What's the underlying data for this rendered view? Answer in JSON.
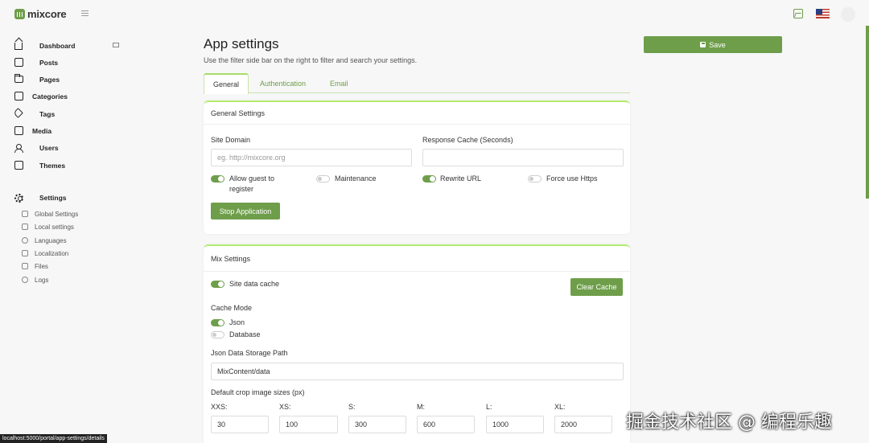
{
  "brand": {
    "name": "mixcore"
  },
  "sidebar": {
    "items": [
      {
        "label": "Dashboard"
      },
      {
        "label": "Posts"
      },
      {
        "label": "Pages"
      },
      {
        "label": "Categories"
      },
      {
        "label": "Tags"
      },
      {
        "label": "Media"
      },
      {
        "label": "Users"
      },
      {
        "label": "Themes"
      },
      {
        "label": "Settings"
      }
    ],
    "settings_sub": [
      {
        "label": "Global Settings"
      },
      {
        "label": "Local settings"
      },
      {
        "label": "Languages"
      },
      {
        "label": "Localization"
      },
      {
        "label": "Files"
      },
      {
        "label": "Logs"
      }
    ]
  },
  "page": {
    "title": "App settings",
    "description": "Use the filter side bar on the right to filter and search your settings.",
    "save_label": "Save"
  },
  "tabs": [
    {
      "label": "General"
    },
    {
      "label": "Authentication"
    },
    {
      "label": "Email"
    }
  ],
  "general": {
    "heading": "General Settings",
    "site_domain_label": "Site Domain",
    "site_domain_placeholder": "eg. http://mixcore.org",
    "response_cache_label": "Response Cache (Seconds)",
    "response_cache_value": "",
    "toggles": [
      {
        "label": "Allow guest to register",
        "on": true
      },
      {
        "label": "Maintenance",
        "on": false
      },
      {
        "label": "Rewrite URL",
        "on": true
      },
      {
        "label": "Force use Https",
        "on": false
      }
    ],
    "stop_button": "Stop Application"
  },
  "mix": {
    "heading": "Mix Settings",
    "site_data_cache_label": "Site data cache",
    "clear_cache_button": "Clear Cache",
    "cache_mode_label": "Cache Mode",
    "cache_modes": [
      {
        "label": "Json",
        "on": true
      },
      {
        "label": "Database",
        "on": false
      }
    ],
    "json_path_label": "Json Data Storage Path",
    "json_path_value": "MixContent/data",
    "crop_label": "Default crop image sizes (px)",
    "sizes": [
      {
        "label": "XXS:",
        "value": "30"
      },
      {
        "label": "XS:",
        "value": "100"
      },
      {
        "label": "S:",
        "value": "300"
      },
      {
        "label": "M:",
        "value": "600"
      },
      {
        "label": "L:",
        "value": "1000"
      },
      {
        "label": "XL:",
        "value": "2000"
      }
    ]
  },
  "status_bar": {
    "url": "localhost:5000/portal/app-settings/details"
  },
  "watermark": {
    "text": "掘金技术社区 @ 编程乐趣"
  },
  "colors": {
    "accent": "#6e9e4a",
    "tab_border": "#b3ec6f"
  }
}
